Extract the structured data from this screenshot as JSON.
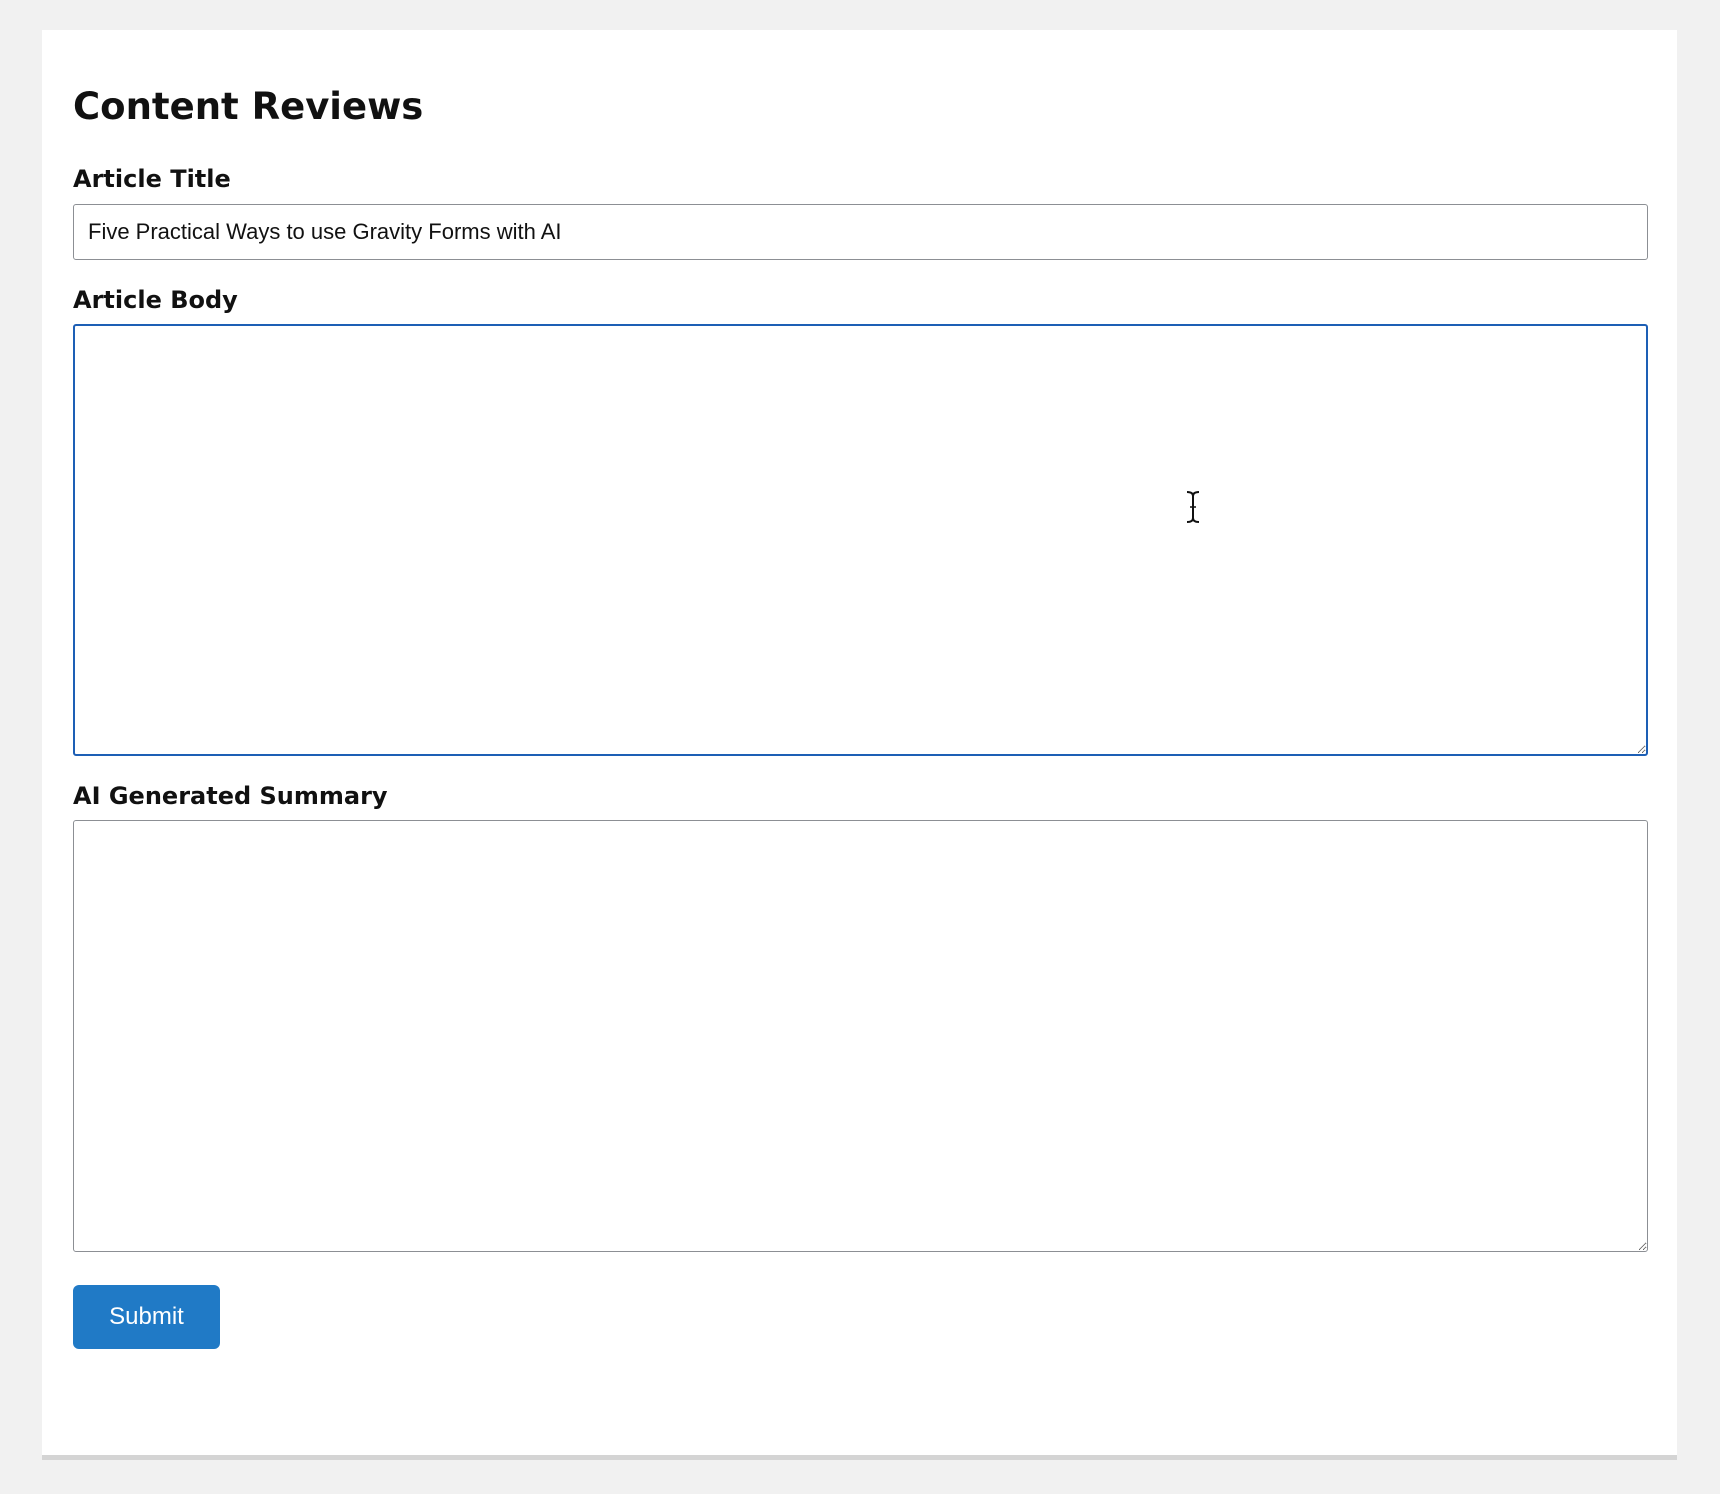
{
  "form": {
    "title": "Content Reviews",
    "fields": {
      "article_title": {
        "label": "Article Title",
        "value": "Five Practical Ways to use Gravity Forms with AI"
      },
      "article_body": {
        "label": "Article Body",
        "value": ""
      },
      "ai_summary": {
        "label": "AI Generated Summary",
        "value": ""
      }
    },
    "submit_label": "Submit"
  },
  "colors": {
    "page_background": "#f1f1f1",
    "card_background": "#ffffff",
    "focus_border": "#1d5fb5",
    "button_background": "#207ac6",
    "button_text": "#ffffff"
  },
  "icons": {
    "cursor": "text-cursor-icon"
  }
}
